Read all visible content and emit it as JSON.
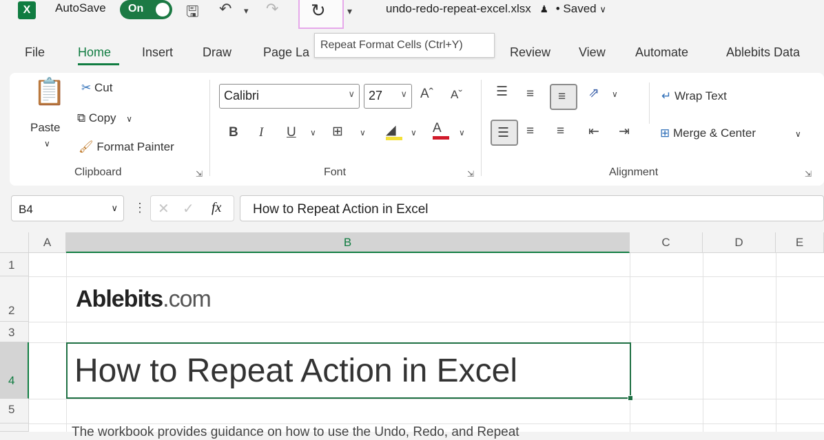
{
  "titlebar": {
    "autosave_label": "AutoSave",
    "autosave_state": "On",
    "filename": "undo-redo-repeat-excel.xlsx",
    "saved_status": "• Saved"
  },
  "tooltip": "Repeat Format Cells (Ctrl+Y)",
  "tabs": [
    "File",
    "Home",
    "Insert",
    "Draw",
    "Page La",
    "Review",
    "View",
    "Automate",
    "Ablebits Data"
  ],
  "ribbon": {
    "clipboard": {
      "paste": "Paste",
      "cut": "Cut",
      "copy": "Copy",
      "format_painter": "Format Painter",
      "label": "Clipboard"
    },
    "font": {
      "font_name": "Calibri",
      "font_size": "27",
      "bold": "B",
      "italic": "I",
      "underline": "U",
      "label": "Font"
    },
    "alignment": {
      "wrap_text": "Wrap Text",
      "merge_center": "Merge & Center",
      "label": "Alignment"
    }
  },
  "formula_bar": {
    "name_box": "B4",
    "fx": "fx",
    "content": "How to Repeat Action in Excel"
  },
  "grid": {
    "columns": [
      "A",
      "B",
      "C",
      "D",
      "E"
    ],
    "rows": [
      "1",
      "2",
      "3",
      "4",
      "5"
    ],
    "logo": {
      "brand": "Ablebits",
      "suffix": ".com"
    },
    "heading": "How to Repeat Action in Excel",
    "body_text": "The workbook provides guidance on how to use the Undo, Redo, and Repeat"
  },
  "colors": {
    "accent": "#107c41",
    "selection": "#1d6f42",
    "tooltip_highlight": "#e6a8ea"
  }
}
